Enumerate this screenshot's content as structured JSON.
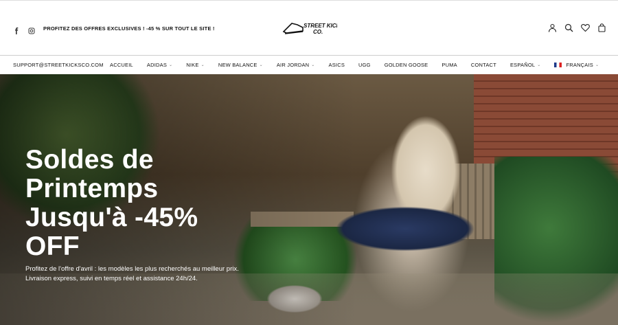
{
  "topbar": {
    "social": [
      "facebook-icon",
      "instagram-icon"
    ],
    "promo": "PROFITEZ DES OFFRES EXCLUSIVES ! -45 % SUR TOUT LE SITE !",
    "logo_line1": "STREET KICKS",
    "logo_line2": "CO.",
    "icons": [
      "user-icon",
      "search-icon",
      "heart-icon",
      "cart-icon"
    ]
  },
  "nav": {
    "email": "SUPPORT@STREETKICKSCO.COM",
    "items": [
      {
        "label": "ACCUEIL",
        "dropdown": false
      },
      {
        "label": "ADIDAS",
        "dropdown": true
      },
      {
        "label": "NIKE",
        "dropdown": true
      },
      {
        "label": "NEW BALANCE",
        "dropdown": true
      },
      {
        "label": "AIR JORDAN",
        "dropdown": true
      },
      {
        "label": "ASICS",
        "dropdown": false
      },
      {
        "label": "UGG",
        "dropdown": false
      },
      {
        "label": "GOLDEN GOOSE",
        "dropdown": false
      },
      {
        "label": "PUMA",
        "dropdown": false
      },
      {
        "label": "CONTACT",
        "dropdown": false
      },
      {
        "label": "ESPAÑOL",
        "dropdown": true
      },
      {
        "label": "FRANÇAIS",
        "dropdown": true
      }
    ]
  },
  "hero": {
    "headline": "Soldes de Printemps Jusqu'à -45% OFF",
    "subtext": "Profitez de l'offre d'avril : les modèles les plus recherchés au meilleur prix. Livraison express, suivi en temps réel et assistance 24h/24."
  },
  "colors": {
    "text": "#111111",
    "hero_text": "#ffffff",
    "divider": "#cccccc"
  }
}
